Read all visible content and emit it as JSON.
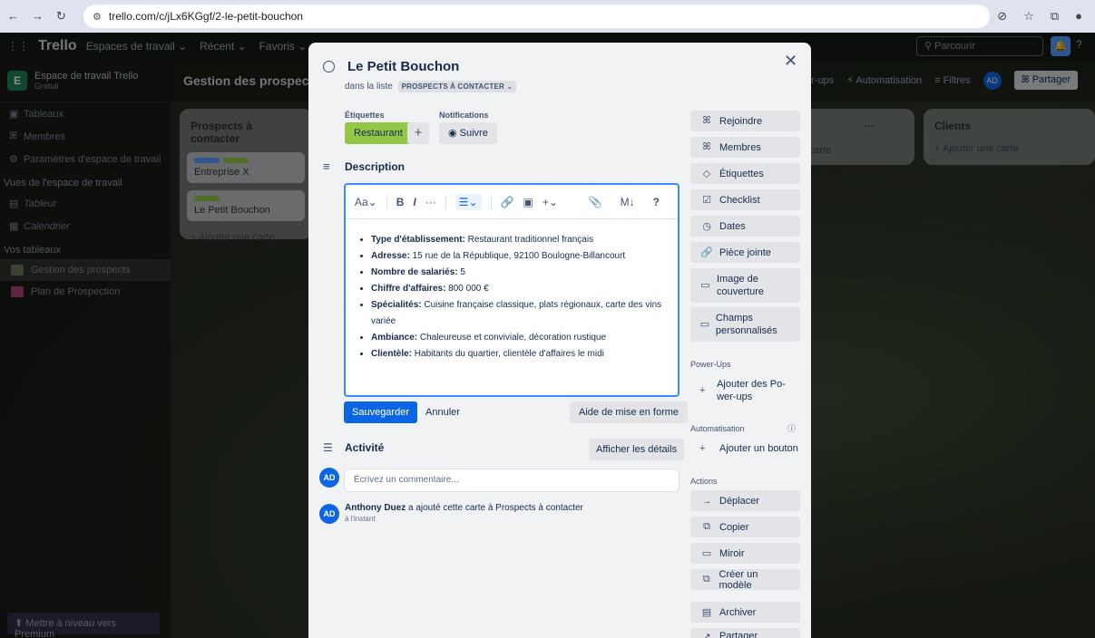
{
  "browser": {
    "url": "trello.com/c/jLx6KGgf/2-le-petit-bouchon"
  },
  "topbar": {
    "logo": "Trello",
    "menus": [
      "Espaces de travail ⌄",
      "Récent ⌄",
      "Favoris ⌄"
    ],
    "search_placeholder": "Parcourir"
  },
  "sidebar": {
    "workspace_name": "Espace de travail Trello",
    "workspace_plan": "Gratuit",
    "items": [
      "Tableaux",
      "Membres",
      "Paramètres d'espace de travail"
    ],
    "views_heading": "Vues de l'espace de travail",
    "views": [
      "Tableur",
      "Calendrier"
    ],
    "boards_heading": "Vos tableaux",
    "boards": [
      {
        "name": "Gestion des prospects",
        "color": "#6b7b5a"
      },
      {
        "name": "Plan de Prospection",
        "color": "#b0447a"
      }
    ],
    "premium": "Mettre à niveau vers Premium"
  },
  "board": {
    "name": "Gestion des prospects",
    "right_items": [
      "er-ups",
      "Automatisation",
      "Filtres"
    ],
    "avatar": "AD",
    "share_label": "Partager"
  },
  "lists": {
    "prospects": {
      "title": "Prospects à contacter",
      "cards": [
        "Entreprise X",
        "Le Petit Bouchon"
      ],
      "add": "Ajouter une carte"
    },
    "middle": {
      "card_fragment": "carte"
    },
    "clients": {
      "title": "Clients",
      "add": "Ajouter une carte"
    }
  },
  "modal": {
    "title": "Le Petit Bouchon",
    "in_list_prefix": "dans la liste",
    "list_chip": "PROSPECTS À CONTACTER ⌄",
    "labels_heading": "Étiquettes",
    "notifications_heading": "Notifications",
    "label_tag": "Restaurant",
    "follow_label": "Suivre",
    "description_heading": "Description",
    "toolbar": {
      "text_style": "Aa⌄",
      "bold": "B",
      "italic": "I",
      "more": "···",
      "list": "☰⌄",
      "link": "🔗",
      "image": "▣",
      "insert": "+⌄",
      "attach": "📎",
      "markdown": "M↓",
      "help": "?"
    },
    "bullets": [
      {
        "key": "Type d'établissement:",
        "value": " Restaurant traditionnel français"
      },
      {
        "key": "Adresse:",
        "value": " 15 rue de la République, 92100 Boulogne-Billancourt"
      },
      {
        "key": "Nombre de salariés:",
        "value": " 5"
      },
      {
        "key": "Chiffre d'affaires:",
        "value": " 800 000 €"
      },
      {
        "key": "Spécialités:",
        "value": " Cuisine française classique, plats régionaux, carte des vins variée"
      },
      {
        "key": "Ambiance:",
        "value": " Chaleureuse et conviviale, décoration rustique"
      },
      {
        "key": "Clientèle:",
        "value": " Habitants du quartier, clientèle d'affaires le midi"
      }
    ],
    "save_label": "Sauvegarder",
    "cancel_label": "Annuler",
    "format_help_label": "Aide de mise en forme",
    "activity_heading": "Activité",
    "details_label": "Afficher les détails",
    "user_initials": "AD",
    "comment_placeholder": "Écrivez un commentaire...",
    "log_user": "Anthony Duez",
    "log_text": " a ajouté cette carte à Prospects à contacter",
    "log_time": "à l'instant",
    "side": {
      "join": "Rejoindre",
      "members": "Membres",
      "labels": "Étiquettes",
      "checklist": "Checklist",
      "dates": "Dates",
      "attachment": "Pièce jointe",
      "cover": "Image de couverture",
      "custom_fields": "Champs personnalisés",
      "powerups_heading": "Power-Ups",
      "add_powerups": "Ajouter des Po-wer-ups",
      "automation_heading": "Automatisation",
      "add_button": "Ajouter un bouton",
      "actions_heading": "Actions",
      "move": "Déplacer",
      "copy": "Copier",
      "mirror": "Miroir",
      "template": "Créer un modèle",
      "archive": "Archiver",
      "share": "Partager"
    }
  }
}
